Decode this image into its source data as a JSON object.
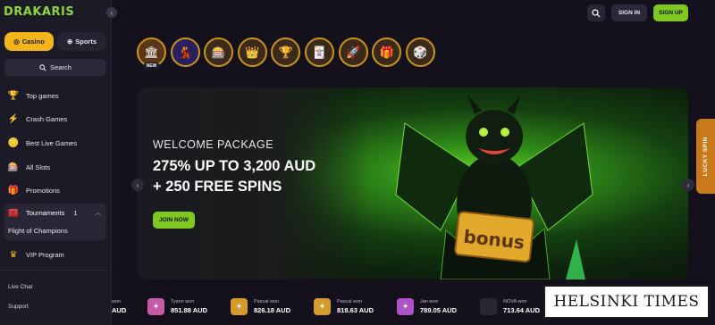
{
  "brand": {
    "logo": "DRAKARIS"
  },
  "sidebar": {
    "collapse_icon": "chevron-left-icon",
    "tabs": [
      {
        "label": "Casino",
        "icon": "casino-chip-icon",
        "active": true
      },
      {
        "label": "Sports",
        "icon": "basketball-icon",
        "active": false
      }
    ],
    "search_label": "Search",
    "items": [
      {
        "label": "Top games",
        "icon": "trophy-icon"
      },
      {
        "label": "Crash Games",
        "icon": "lightning-icon"
      },
      {
        "label": "Best Live Games",
        "icon": "coins-icon"
      },
      {
        "label": "All Slots",
        "icon": "slots-icon"
      },
      {
        "label": "Promotions",
        "icon": "gift-icon"
      }
    ],
    "tournaments": {
      "label": "Tournaments",
      "count": "1",
      "sub_item": "Flight of Champions",
      "icon": "chest-icon"
    },
    "vip": {
      "label": "VIP Program",
      "icon": "crown-icon"
    },
    "live_chat": "Live Chat",
    "support": "Support"
  },
  "header": {
    "sign_in": "SIGN IN",
    "sign_up": "SIGN UP",
    "search_icon": "search-icon"
  },
  "categories": [
    {
      "name": "new-games",
      "tag": "NEW",
      "glyph": "🏛"
    },
    {
      "name": "live-casino",
      "tag": "",
      "glyph": "💃"
    },
    {
      "name": "slots",
      "tag": "",
      "glyph": "🎰"
    },
    {
      "name": "vip",
      "tag": "",
      "glyph": "👑"
    },
    {
      "name": "top-games",
      "tag": "",
      "glyph": "🏆"
    },
    {
      "name": "table-games",
      "tag": "",
      "glyph": "🃏"
    },
    {
      "name": "crash-games",
      "tag": "",
      "glyph": "🚀"
    },
    {
      "name": "promotions",
      "tag": "",
      "glyph": "🎁"
    },
    {
      "name": "other",
      "tag": "",
      "glyph": "🎲"
    }
  ],
  "banner": {
    "title": "WELCOME PACKAGE",
    "line1": "275% UP TO 3,200 AUD",
    "line2": "+ 250 FREE SPINS",
    "cta": "JOIN NOW",
    "art_text": "bonus"
  },
  "lucky_spin": "LUCKY SPIN",
  "wins": [
    {
      "who": "won",
      "amount": "AUD",
      "color": "#3b2a4a"
    },
    {
      "who": "Tyson won",
      "amount": "851.88 AUD",
      "color": "#c65aa8"
    },
    {
      "who": "Pascal won",
      "amount": "826.18 AUD",
      "color": "#d69a2a"
    },
    {
      "who": "Pascal won",
      "amount": "818.63 AUD",
      "color": "#d69a2a"
    },
    {
      "who": "Jan won",
      "amount": "789.05 AUD",
      "color": "#b052c9"
    },
    {
      "who": "NOVA won",
      "amount": "713.64 AUD",
      "color": "#2a2636"
    }
  ],
  "watermark": "HELSINKI TIMES"
}
